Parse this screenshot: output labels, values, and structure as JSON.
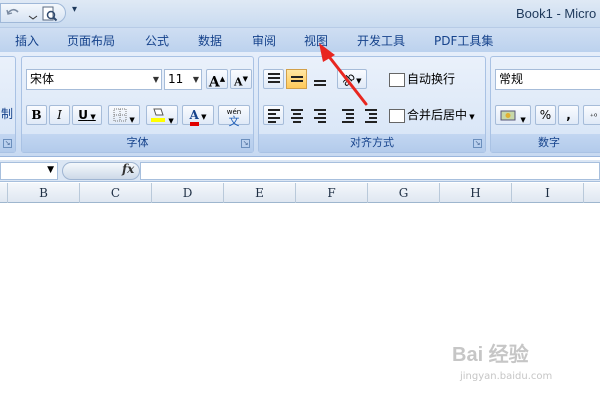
{
  "window": {
    "title": "Book1 - Micro"
  },
  "quick_access": {
    "icons": [
      "undo-icon",
      "print-preview-icon",
      "customize-arrow-icon"
    ]
  },
  "tabs": [
    "插入",
    "页面布局",
    "公式",
    "数据",
    "审阅",
    "视图",
    "开发工具",
    "PDF工具集"
  ],
  "ribbon": {
    "clipboard_partial_label": "制",
    "font_group": {
      "label": "字体",
      "font_name": "宋体",
      "font_size": "11",
      "grow_label": "A",
      "shrink_label": "A",
      "bold": "B",
      "italic": "I",
      "underline": "U",
      "font_color_letter": "A",
      "phonetic_top": "wén",
      "phonetic_bottom": "文"
    },
    "alignment_group": {
      "label": "对齐方式",
      "wrap_text": "自动换行",
      "merge_center": "合并后居中"
    },
    "number_group": {
      "label": "数字",
      "format": "常规",
      "percent": "%",
      "comma": ","
    }
  },
  "formula_bar": {
    "fx": "fx",
    "value": ""
  },
  "columns": [
    "B",
    "C",
    "D",
    "E",
    "F",
    "G",
    "H",
    "I"
  ],
  "annotation": {
    "target_tab": "视图",
    "color": "#e8261f"
  },
  "watermark": {
    "logo": "Bai 经验",
    "url": "jingyan.baidu.com"
  },
  "colors": {
    "ribbon_text": "#15428b",
    "highlight": "#ffc95a",
    "fill_yellow": "#ffff00",
    "font_red": "#e00000"
  }
}
